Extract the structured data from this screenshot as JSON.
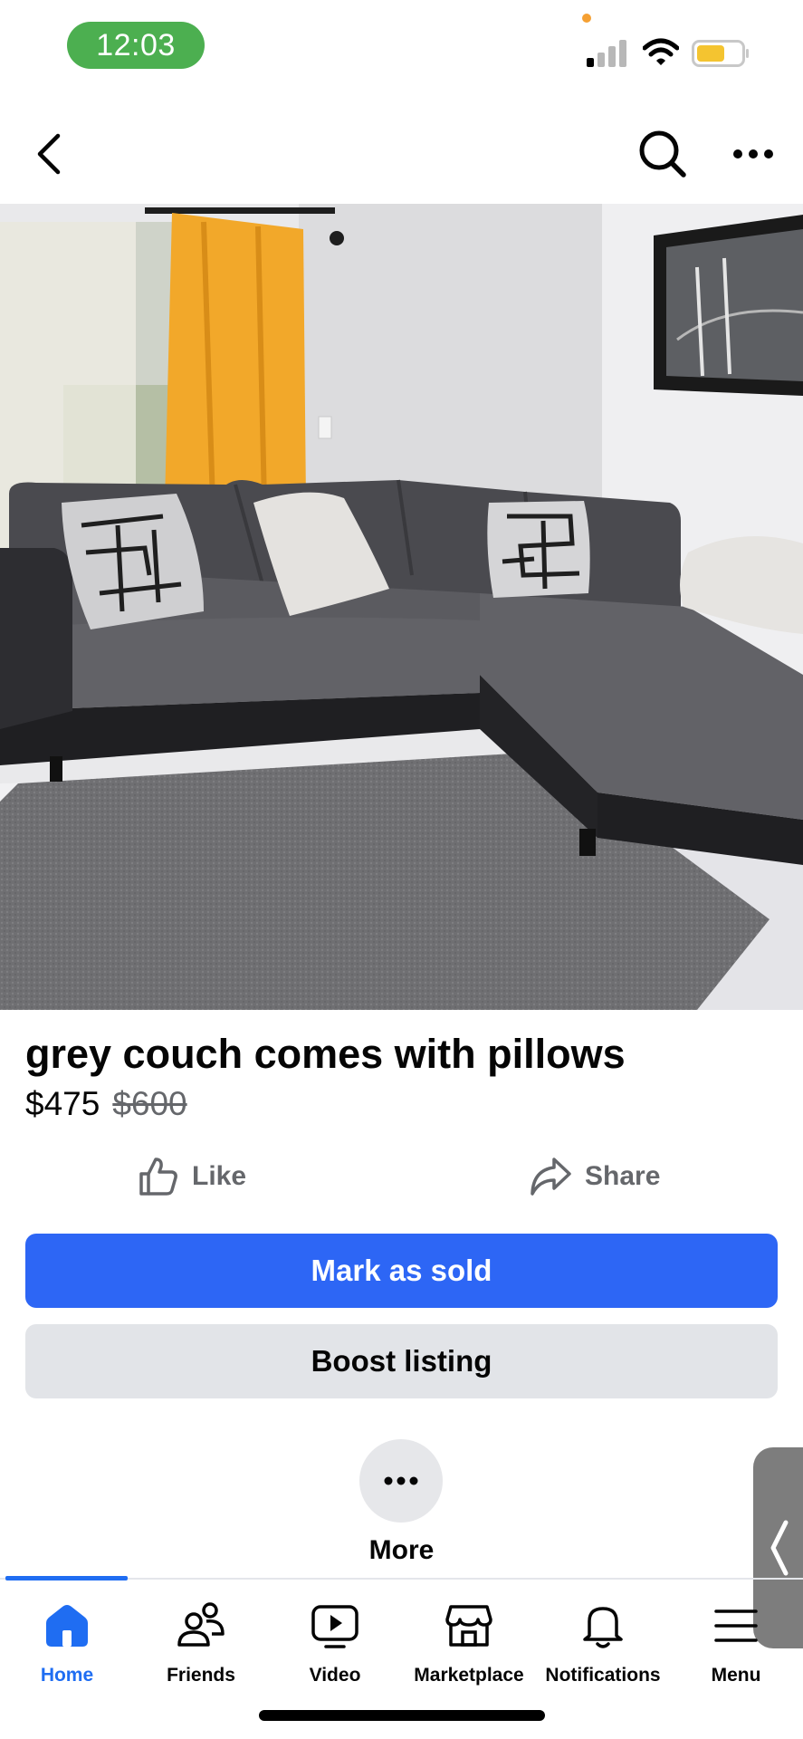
{
  "status_bar": {
    "time": "12:03"
  },
  "top_nav": {
    "icons": [
      "back-icon",
      "search-icon",
      "more-horizontal-icon"
    ]
  },
  "listing": {
    "title": "grey couch comes with pillows",
    "price": "$475",
    "original_price": "$600",
    "like_label": "Like",
    "share_label": "Share",
    "mark_sold_label": "Mark as sold",
    "boost_label": "Boost listing",
    "more_label": "More"
  },
  "tabs": [
    {
      "label": "Home",
      "icon": "home-icon",
      "active": true
    },
    {
      "label": "Friends",
      "icon": "friends-icon",
      "active": false
    },
    {
      "label": "Video",
      "icon": "video-icon",
      "active": false
    },
    {
      "label": "Marketplace",
      "icon": "marketplace-icon",
      "active": false
    },
    {
      "label": "Notifications",
      "icon": "bell-icon",
      "active": false
    },
    {
      "label": "Menu",
      "icon": "menu-icon",
      "active": false
    }
  ],
  "colors": {
    "accent": "#2d66f5",
    "active_tab": "#1f6df2",
    "time_pill": "#4caf50",
    "secondary_button": "#e2e4e8",
    "muted_text": "#65676b"
  }
}
